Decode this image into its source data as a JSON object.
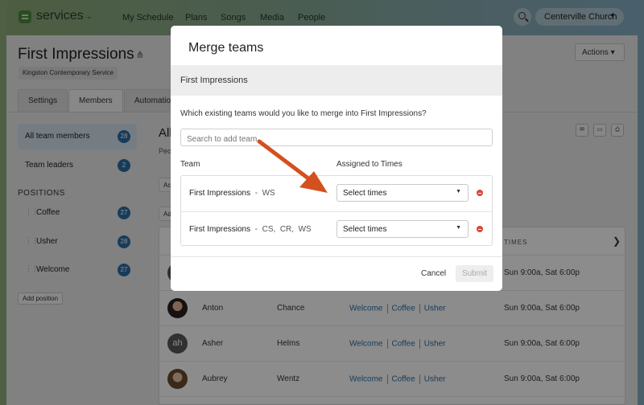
{
  "nav": {
    "brand": "services",
    "items": [
      "My Schedule",
      "Plans",
      "Songs",
      "Media",
      "People"
    ],
    "org": "Centerville Church"
  },
  "page": {
    "title": "First Impressions",
    "service_tag": "Kingston Contemporary Service",
    "actions_label": "Actions",
    "tabs": [
      "Settings",
      "Members",
      "Automation"
    ]
  },
  "sidebar": {
    "all_members": {
      "label": "All team members",
      "count": "28"
    },
    "leaders": {
      "label": "Team leaders",
      "count": "2"
    },
    "positions_heading": "POSITIONS",
    "positions": [
      {
        "label": "Coffee",
        "count": "27"
      },
      {
        "label": "Usher",
        "count": "28"
      },
      {
        "label": "Welcome",
        "count": "27"
      }
    ],
    "add_position": "Add position"
  },
  "main": {
    "title_fragment": "All",
    "subtitle_fragment": "Peo",
    "stub_buttons": [
      "Ac",
      "Ad"
    ],
    "times_header": "TIMES",
    "rows": [
      {
        "first": "",
        "last": "",
        "positions": [],
        "times": "Sun 9:00a, Sat 6:00p"
      },
      {
        "first": "Anton",
        "last": "Chance",
        "positions": [
          "Welcome",
          "Coffee",
          "Usher"
        ],
        "times": "Sun 9:00a, Sat 6:00p"
      },
      {
        "first": "Asher",
        "last": "Helms",
        "initials": "ah",
        "positions": [
          "Welcome",
          "Coffee",
          "Usher"
        ],
        "times": "Sun 9:00a, Sat 6:00p"
      },
      {
        "first": "Aubrey",
        "last": "Wentz",
        "positions": [
          "Welcome",
          "Coffee",
          "Usher"
        ],
        "times": "Sun 9:00a, Sat 6:00p"
      }
    ]
  },
  "modal": {
    "title": "Merge teams",
    "target_team": "First Impressions",
    "question": "Which existing teams would you like to merge into First Impressions?",
    "search_placeholder": "Search to add team",
    "col_team": "Team",
    "col_times": "Assigned to Times",
    "teams": [
      {
        "name": "First Impressions",
        "dash": "-",
        "locations": "WS",
        "select": "Select times"
      },
      {
        "name": "First Impressions",
        "dash": "-",
        "locations": "CS,  CR,  WS",
        "select": "Select times"
      }
    ],
    "cancel": "Cancel",
    "submit": "Submit"
  },
  "colors": {
    "accent": "#2b6ea7",
    "arrow": "#d4501e",
    "danger": "#d9473a",
    "brand_green": "#4d8a3a"
  }
}
